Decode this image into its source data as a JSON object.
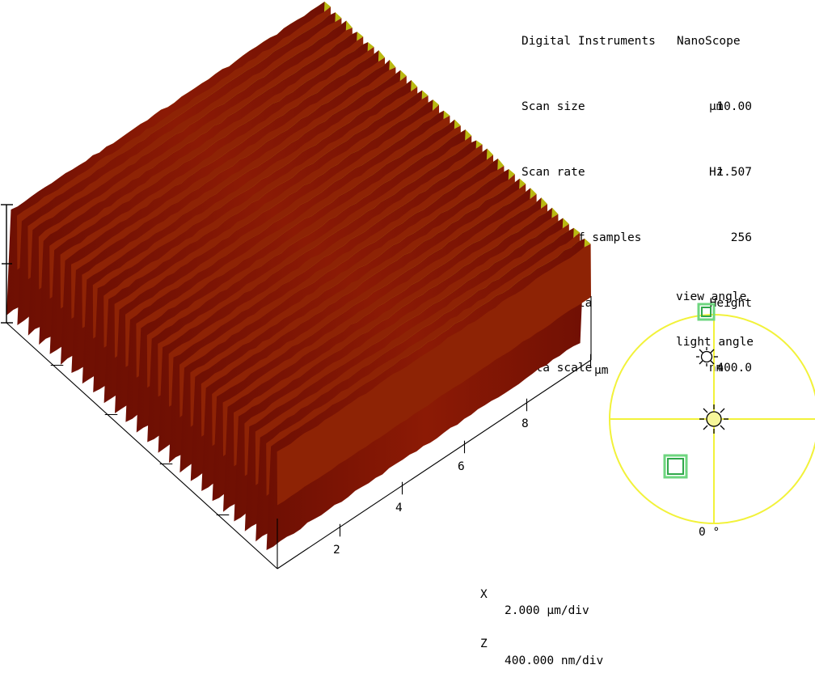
{
  "header": {
    "title": "Digital Instruments   NanoScope",
    "rows": [
      {
        "label": "Scan size",
        "value": "10.00",
        "unit": "µm"
      },
      {
        "label": "Scan rate",
        "value": "1.507",
        "unit": "Hz"
      },
      {
        "label": "Number of samples",
        "value": "256",
        "unit": ""
      },
      {
        "label": "Image Data",
        "value": "Height",
        "unit": ""
      },
      {
        "label": "Data scale",
        "value": "400.0",
        "unit": "nm"
      }
    ]
  },
  "plot": {
    "x_axis": {
      "unit_label": "µm",
      "tick_labels": [
        "2",
        "4",
        "6",
        "8"
      ]
    },
    "y_axis": {
      "tick_labels": []
    },
    "z_axis": {
      "tick_labels": []
    }
  },
  "scale_legend": {
    "rows": [
      {
        "axis": "X",
        "value": "2.000 µm/div"
      },
      {
        "axis": "Z",
        "value": "400.000 nm/div"
      }
    ]
  },
  "angle_legend": {
    "rows": [
      {
        "icon": "green-square-icon",
        "label": "view angle"
      },
      {
        "icon": "sun-icon",
        "label": "light angle"
      }
    ]
  },
  "compass": {
    "degree_label": "0 °",
    "circle_color": "#f2f23a",
    "view_marker_color": "#2fbe4f",
    "light_marker_color": "#000000"
  },
  "colors": {
    "background": "#ffffff",
    "axis": "#000000",
    "surface_high": "#c9c915",
    "surface_mid": "#c07a0a",
    "surface_low": "#8a1605",
    "text": "#000000"
  },
  "chart_data": {
    "type": "surface",
    "title": "Digital Instruments   NanoScope",
    "description": "3D AFM height rendering of a periodic grating surface",
    "scan_size_um": 10.0,
    "scan_rate_hz": 1.507,
    "samples": 256,
    "image_data": "Height",
    "data_scale_nm": 400.0,
    "x_div_um": 2.0,
    "z_div_nm": 400.0,
    "xlim": [
      0,
      10
    ],
    "xticks": [
      2,
      4,
      6,
      8
    ],
    "xlabel": "µm",
    "zlabel": "nm",
    "grating_ridge_count": 25,
    "grating_period_um": 0.4,
    "ridge_height_nm": 400,
    "view_angle_deg": 0,
    "colormap": [
      "#8a1605",
      "#c07a0a",
      "#c9c915"
    ]
  }
}
